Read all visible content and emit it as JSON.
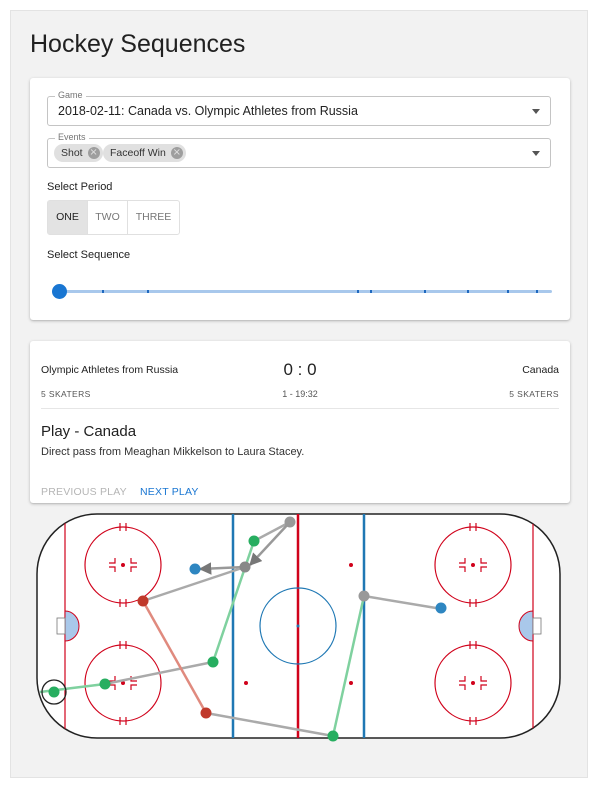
{
  "page": {
    "title": "Hockey Sequences"
  },
  "filters": {
    "game": {
      "legend": "Game",
      "value": "2018-02-11: Canada vs. Olympic Athletes from Russia"
    },
    "events": {
      "legend": "Events",
      "chips": [
        "Shot",
        "Faceoff Win"
      ]
    },
    "period": {
      "label": "Select Period",
      "options": [
        "ONE",
        "TWO",
        "THREE"
      ],
      "selected": "ONE"
    },
    "sequence": {
      "label": "Select Sequence",
      "value_fraction": 0.0
    }
  },
  "play": {
    "home_team": "Olympic Athletes from Russia",
    "away_team": "Canada",
    "home_skaters": "5 SKATERS",
    "away_skaters": "5 SKATERS",
    "score": "0 : 0",
    "clock": "1 - 19:32",
    "title": "Play - Canada",
    "description": "Direct pass from Meaghan Mikkelson to Laura Stacey.",
    "prev_label": "PREVIOUS PLAY",
    "next_label": "NEXT PLAY"
  },
  "colors": {
    "accent": "#1976d2",
    "canada_event": "#27ae60",
    "russia_event": "#c0392b",
    "neutral_event": "#999999",
    "other_event": "#2e86c1",
    "rink_red": "#d0021b",
    "rink_blue": "#1f78b4"
  }
}
